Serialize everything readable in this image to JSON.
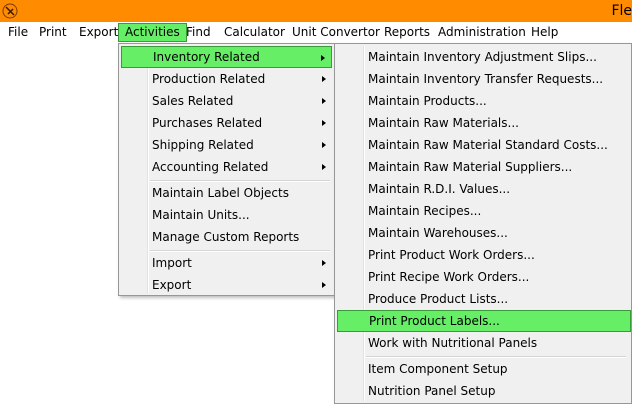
{
  "window": {
    "title": "Fle"
  },
  "menubar": {
    "items": [
      "File",
      "Print",
      "Export",
      "Activities",
      "Find",
      "Calculator",
      "Unit Convertor",
      "Reports",
      "Administration",
      "Help"
    ],
    "active": "Activities"
  },
  "activities_menu": {
    "items": [
      {
        "label": "Inventory Related",
        "submenu": true,
        "highlighted": true
      },
      {
        "label": "Production Related",
        "submenu": true
      },
      {
        "label": "Sales Related",
        "submenu": true
      },
      {
        "label": "Purchases Related",
        "submenu": true
      },
      {
        "label": "Shipping Related",
        "submenu": true
      },
      {
        "label": "Accounting Related",
        "submenu": true
      },
      {
        "label": "Maintain Label Objects",
        "submenu": false
      },
      {
        "label": "Maintain Units...",
        "submenu": false
      },
      {
        "label": "Manage Custom Reports",
        "submenu": false
      },
      {
        "label": "Import",
        "submenu": true
      },
      {
        "label": "Export",
        "submenu": true
      }
    ]
  },
  "inventory_submenu": {
    "items": [
      {
        "label": "Maintain Inventory Adjustment Slips..."
      },
      {
        "label": "Maintain Inventory Transfer Requests..."
      },
      {
        "label": "Maintain Products..."
      },
      {
        "label": "Maintain Raw Materials..."
      },
      {
        "label": "Maintain Raw Material Standard Costs..."
      },
      {
        "label": "Maintain Raw Material Suppliers..."
      },
      {
        "label": "Maintain R.D.I. Values..."
      },
      {
        "label": "Maintain Recipes..."
      },
      {
        "label": "Maintain Warehouses..."
      },
      {
        "label": "Print Product Work Orders..."
      },
      {
        "label": "Print Recipe Work Orders..."
      },
      {
        "label": "Produce Product Lists..."
      },
      {
        "label": "Print Product Labels...",
        "highlighted": true
      },
      {
        "label": "Work with Nutritional Panels"
      },
      {
        "label": "Item Component Setup"
      },
      {
        "label": "Nutrition Panel Setup"
      }
    ]
  },
  "colors": {
    "titlebar": "#ff8c00",
    "highlight": "#66ee66",
    "menu_bg": "#f0f0f0"
  }
}
